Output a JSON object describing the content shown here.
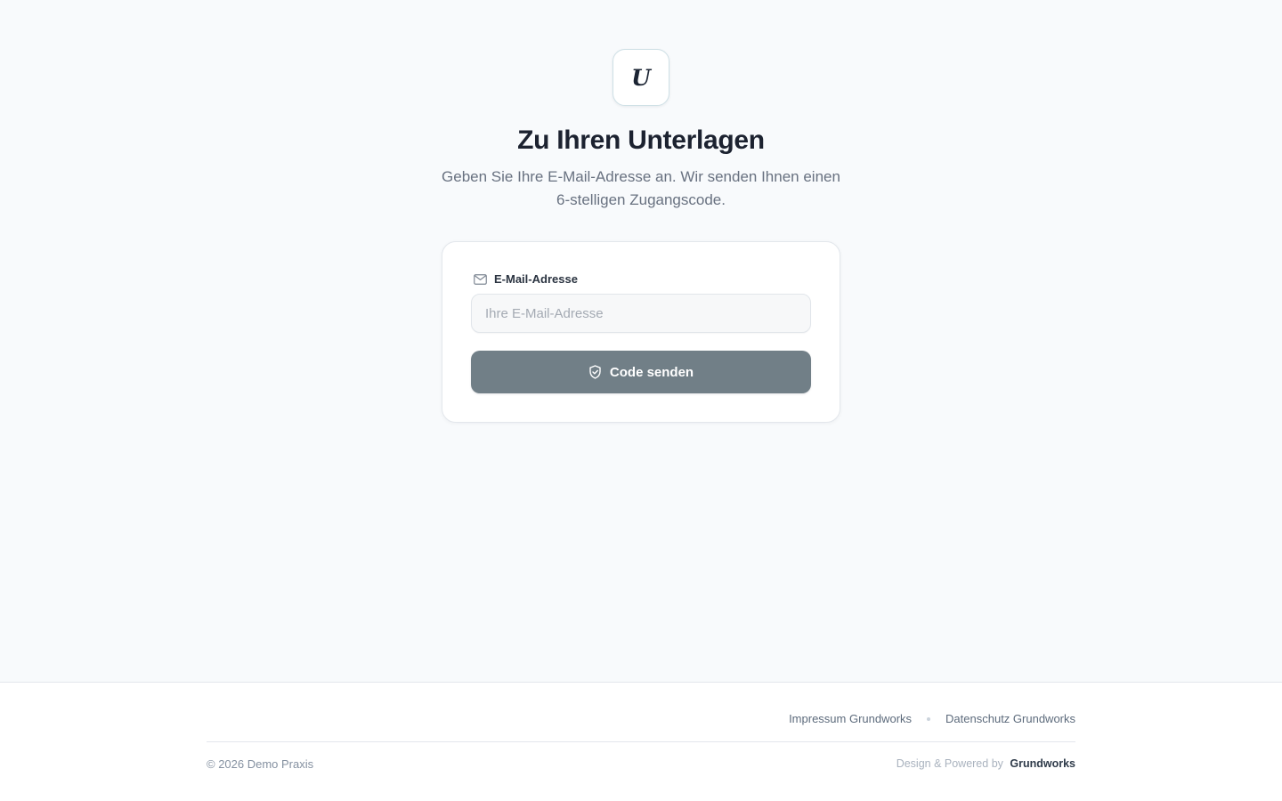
{
  "logo": {
    "letter": "U"
  },
  "header": {
    "title": "Zu Ihren Unterlagen",
    "subtitle": "Geben Sie Ihre E-Mail-Adresse an. Wir senden Ihnen einen 6-stelligen Zugangscode."
  },
  "form": {
    "email_label": "E-Mail-Adresse",
    "email_label_icon": "mail-icon",
    "email_value": "",
    "email_placeholder": "Ihre E-Mail-Adresse",
    "submit_label": "Code senden",
    "submit_icon": "shield-check-icon",
    "submit_color": "#717f87"
  },
  "footer": {
    "links": [
      {
        "label": "Impressum Grundworks"
      },
      {
        "label": "Datenschutz Grundworks"
      }
    ],
    "copyright": "© 2026 Demo Praxis",
    "powered_prefix": "Design & Powered by",
    "powered_brand": "Grundworks"
  },
  "colors": {
    "background": "#f8fafc",
    "title": "#1c2230",
    "subtitle": "#687180",
    "accent_button": "#717f87"
  }
}
